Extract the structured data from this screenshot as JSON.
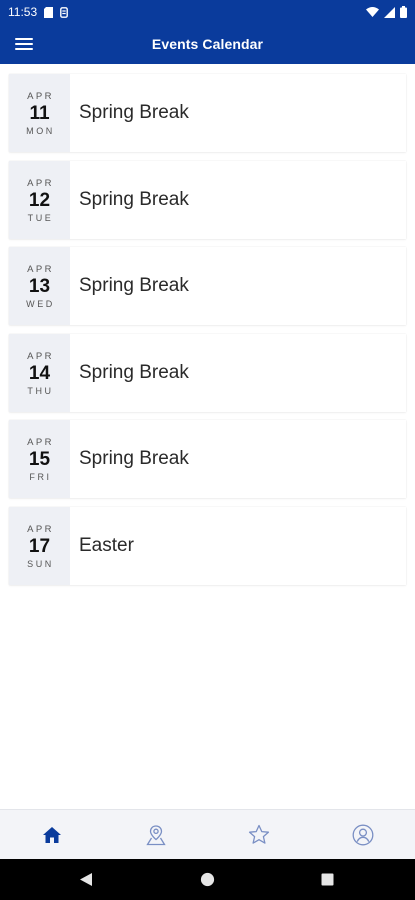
{
  "status_bar": {
    "time": "11:53",
    "icons": [
      "sd-card-icon",
      "notification-icon",
      "wifi-icon",
      "signal-icon",
      "battery-icon"
    ]
  },
  "app_bar": {
    "title": "Events Calendar",
    "menu_icon": "hamburger-menu-icon"
  },
  "events": [
    {
      "month": "APR",
      "day": "11",
      "weekday": "MON",
      "title": "Spring Break"
    },
    {
      "month": "APR",
      "day": "12",
      "weekday": "TUE",
      "title": "Spring Break"
    },
    {
      "month": "APR",
      "day": "13",
      "weekday": "WED",
      "title": "Spring Break"
    },
    {
      "month": "APR",
      "day": "14",
      "weekday": "THU",
      "title": "Spring Break"
    },
    {
      "month": "APR",
      "day": "15",
      "weekday": "FRI",
      "title": "Spring Break"
    },
    {
      "month": "APR",
      "day": "17",
      "weekday": "SUN",
      "title": "Easter"
    }
  ],
  "bottom_nav": {
    "items": [
      "home-icon",
      "location-icon",
      "star-icon",
      "profile-icon"
    ],
    "active": "home-icon"
  },
  "system_nav": [
    "back-icon",
    "home-circle-icon",
    "recents-icon"
  ],
  "colors": {
    "brand": "#0a3b9c",
    "date_block_bg": "#eef0f5",
    "nav_bg": "#f3f4f8"
  }
}
